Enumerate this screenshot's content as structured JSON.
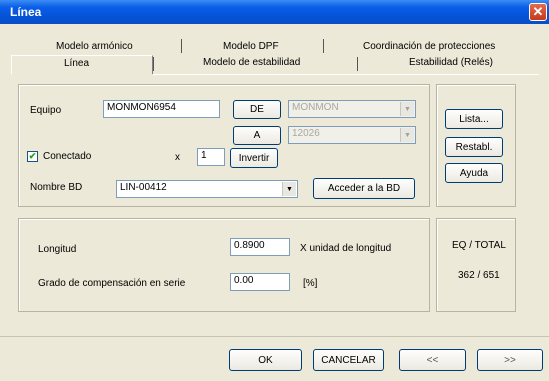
{
  "window": {
    "title": "Línea",
    "close_glyph": "✕"
  },
  "tabs": {
    "top_row": [
      "Modelo armónico",
      "Modelo DPF",
      "Coordinación de protecciones"
    ],
    "bottom_row": [
      "Línea",
      "Modelo de estabilidad",
      "Estabilidad (Relés)"
    ],
    "active": "Línea"
  },
  "form": {
    "equipo_label": "Equipo",
    "equipo_value": "MONMON6954",
    "de_label": "DE",
    "de_value": "MONMON",
    "a_label": "A",
    "a_value": "12026",
    "conectado_label": "Conectado",
    "conectado_checked": true,
    "x_label": "x",
    "x_value": "1",
    "invertir_label": "Invertir",
    "nombre_bd_label": "Nombre BD",
    "nombre_bd_value": "LIN-00412",
    "acceder_label": "Acceder a la BD"
  },
  "side_buttons": {
    "lista": "Lista...",
    "restabl": "Restabl.",
    "ayuda": "Ayuda"
  },
  "params": {
    "longitud_label": "Longitud",
    "longitud_value": "0.8900",
    "longitud_unit": "X unidad de longitud",
    "grado_label": "Grado de compensación en serie",
    "grado_value": "0.00",
    "grado_unit": "[%]"
  },
  "stats": {
    "label": "EQ / TOTAL",
    "value": "362 / 651"
  },
  "footer": {
    "ok": "OK",
    "cancelar": "CANCELAR",
    "prev": "<<",
    "next": ">>"
  }
}
